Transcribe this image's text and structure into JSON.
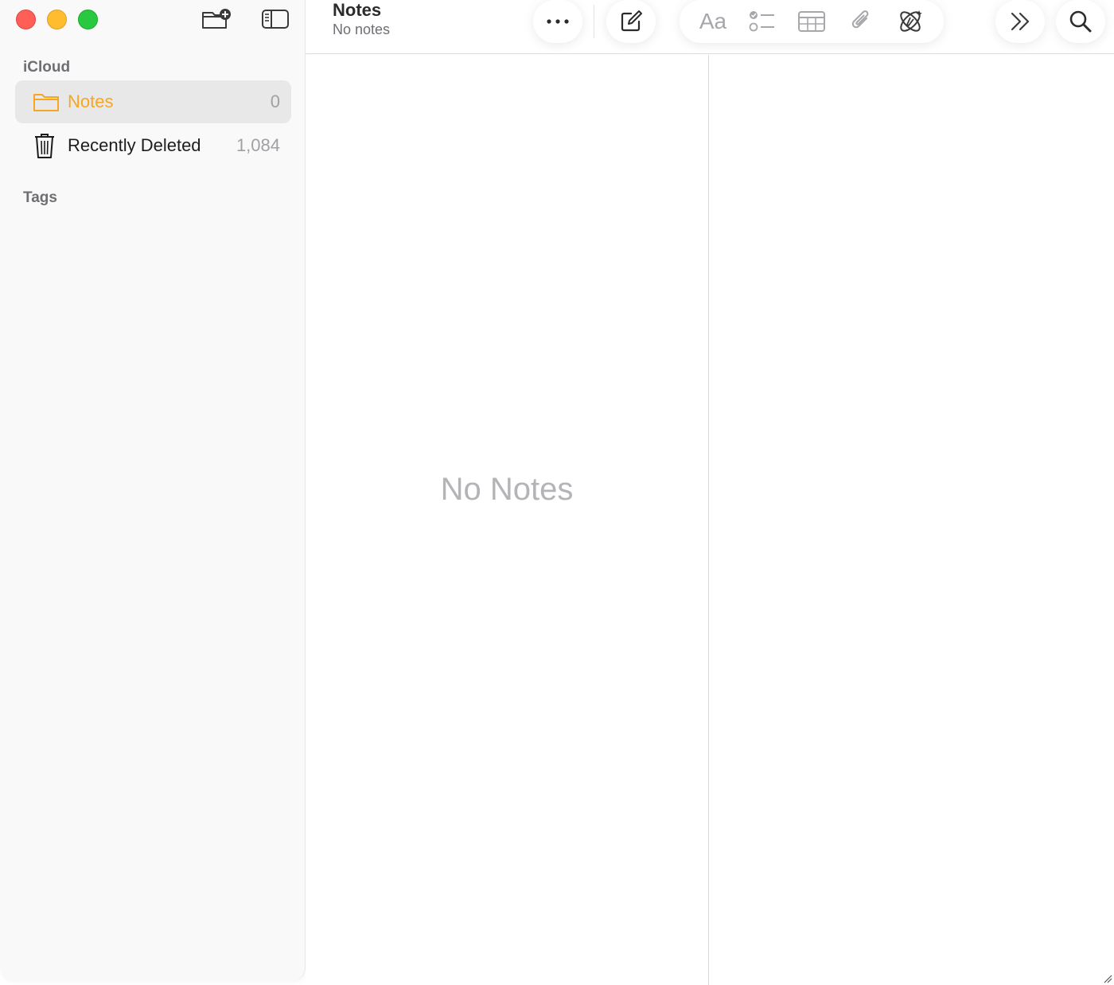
{
  "window": {
    "controls": [
      "close",
      "minimize",
      "zoom"
    ],
    "colors": {
      "close": "#ff5f57",
      "minimize": "#febc2e",
      "zoom": "#28c840",
      "accent": "#f5a623"
    }
  },
  "sidebar": {
    "toolbar_icons": [
      "new-folder-icon",
      "sidebar-toggle-icon"
    ],
    "section_icloud": "iCloud",
    "folders": [
      {
        "label": "Notes",
        "count": "0",
        "icon": "folder-icon",
        "selected": true
      },
      {
        "label": "Recently Deleted",
        "count": "1,084",
        "icon": "trash-icon",
        "selected": false
      }
    ],
    "section_tags": "Tags"
  },
  "header": {
    "title": "Notes",
    "subtitle": "No notes",
    "toolbar_icons": [
      "more-icon",
      "compose-icon",
      "text-format-icon",
      "checklist-icon",
      "table-icon",
      "attachment-icon",
      "writing-tools-icon",
      "forward-chevrons-icon",
      "search-icon"
    ],
    "format_label": "Aa"
  },
  "list": {
    "empty_message": "No Notes"
  }
}
